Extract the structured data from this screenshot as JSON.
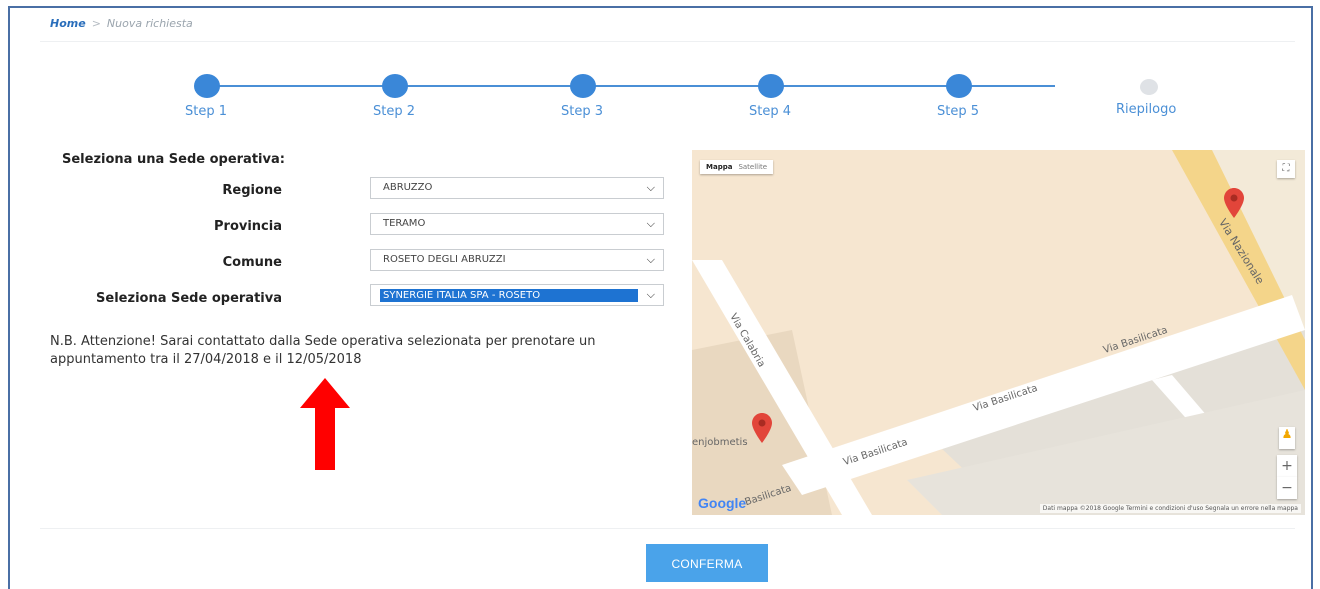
{
  "breadcrumb": {
    "home": "Home",
    "current": "Nuova richiesta"
  },
  "stepper": {
    "steps": [
      "Step 1",
      "Step 2",
      "Step 3",
      "Step 4",
      "Step 5",
      "Riepilogo"
    ],
    "active_color": "#3a87d8",
    "inactive_color": "#dfe2e6"
  },
  "form": {
    "title": "Seleziona una Sede operativa:",
    "regione_label": "Regione",
    "regione_value": "ABRUZZO",
    "provincia_label": "Provincia",
    "provincia_value": "TERAMO",
    "comune_label": "Comune",
    "comune_value": "ROSETO DEGLI ABRUZZI",
    "sede_label": "Seleziona Sede operativa",
    "sede_value": "SYNERGIE ITALIA SPA - ROSETO"
  },
  "note": "N.B. Attenzione! Sarai contattato dalla Sede operativa selezionata per prenotare un appuntamento tra il 27/04/2018 e il 12/05/2018",
  "map": {
    "type_map": "Mappa",
    "type_satellite": "Satellite",
    "streets": [
      "Via Nazionale",
      "Via Calabria",
      "Via Basilicata",
      "Via Basilicata",
      "Via Basilicata",
      "Basilicata"
    ],
    "poi": "enjobmetis",
    "logo": "Google",
    "attribution": "Dati mappa ©2018 Google   Termini e condizioni d'uso   Segnala un errore nella mappa",
    "zoom_in": "+",
    "zoom_out": "−"
  },
  "confirm_label": "CONFERMA",
  "accent_color": "#4aa3ea",
  "arrow_color": "#ff0000"
}
